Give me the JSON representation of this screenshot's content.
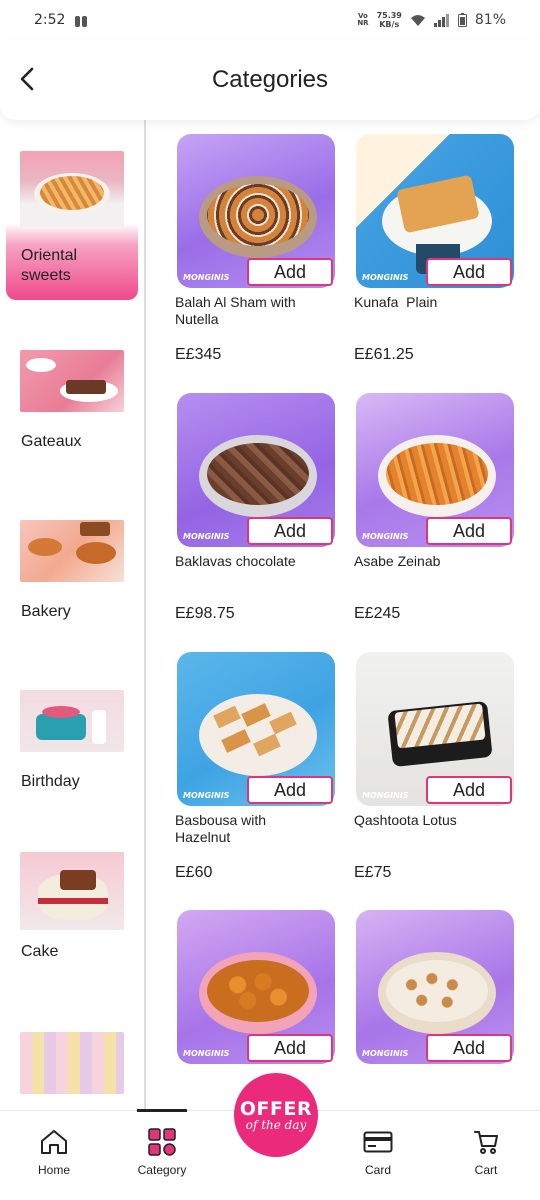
{
  "status": {
    "time": "2:52",
    "network_badge": "Vo\nNR",
    "speed": "75.39\nKB/s",
    "battery": "81%"
  },
  "header": {
    "title": "Categories"
  },
  "categories": [
    {
      "label": "Oriental\nsweets",
      "active": true
    },
    {
      "label": "Gateaux",
      "active": false
    },
    {
      "label": "Bakery",
      "active": false
    },
    {
      "label": "Birthday",
      "active": false
    },
    {
      "label": "Cake",
      "active": false
    },
    {
      "label": "",
      "active": false
    }
  ],
  "products": [
    {
      "name": "Balah Al Sham with Nutella",
      "price": "E£345",
      "add_label": "Add",
      "brand": "MONGINIS"
    },
    {
      "name": "Kunafa  Plain",
      "price": "E£61.25",
      "add_label": "Add",
      "brand": "MONGINIS"
    },
    {
      "name": "Baklavas chocolate",
      "price": "E£98.75",
      "add_label": "Add",
      "brand": "MONGINIS"
    },
    {
      "name": "Asabe Zeinab",
      "price": "E£245",
      "add_label": "Add",
      "brand": "MONGINIS"
    },
    {
      "name": "Basbousa with Hazelnut",
      "price": "E£60",
      "add_label": "Add",
      "brand": "MONGINIS"
    },
    {
      "name": "Qashtoota Lotus",
      "price": "E£75",
      "add_label": "Add",
      "brand": "MONGINIS"
    },
    {
      "name": "",
      "price": "",
      "add_label": "Add",
      "brand": "MONGINIS"
    },
    {
      "name": "",
      "price": "",
      "add_label": "Add",
      "brand": "MONGINIS"
    }
  ],
  "offer": {
    "line1": "OFFER",
    "line2": "of the day"
  },
  "bottom_nav": {
    "home": "Home",
    "category": "Category",
    "card": "Card",
    "cart": "Cart"
  },
  "colors": {
    "accent_pink": "#ec2a7b",
    "add_border": "#e0357a"
  },
  "icons": {
    "back": "chevron-left-icon",
    "home": "home-icon",
    "category": "category-grid-icon",
    "card": "credit-card-icon",
    "cart": "cart-icon"
  }
}
